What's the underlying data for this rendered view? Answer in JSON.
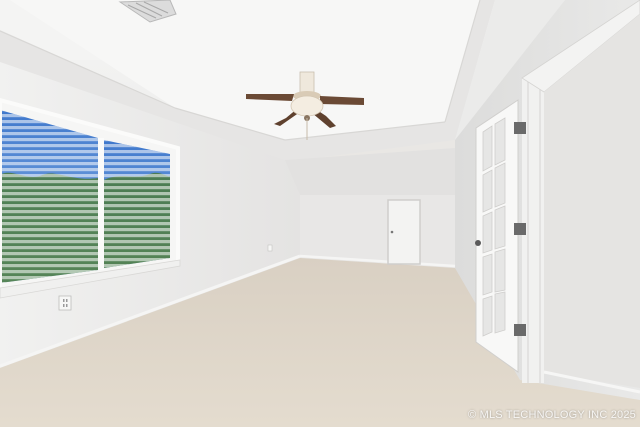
{
  "watermark": "© MLS TECHNOLOGY INC 2025",
  "colors": {
    "ceiling": "#f2f2f0",
    "wall_left": "#ebeaea",
    "wall_back": "#e7e6e5",
    "wall_right": "#e4e3e2",
    "carpet": "#ddd4c7",
    "trim": "#f8f8f7",
    "fan_blade": "#6b4a35",
    "sky": "#5d8fd6",
    "trees": "#4a7a3c"
  },
  "icons": [
    "air-vent-icon",
    "ceiling-fan-icon",
    "door-hinge-icon",
    "door-knob-icon",
    "electrical-outlet-icon"
  ]
}
